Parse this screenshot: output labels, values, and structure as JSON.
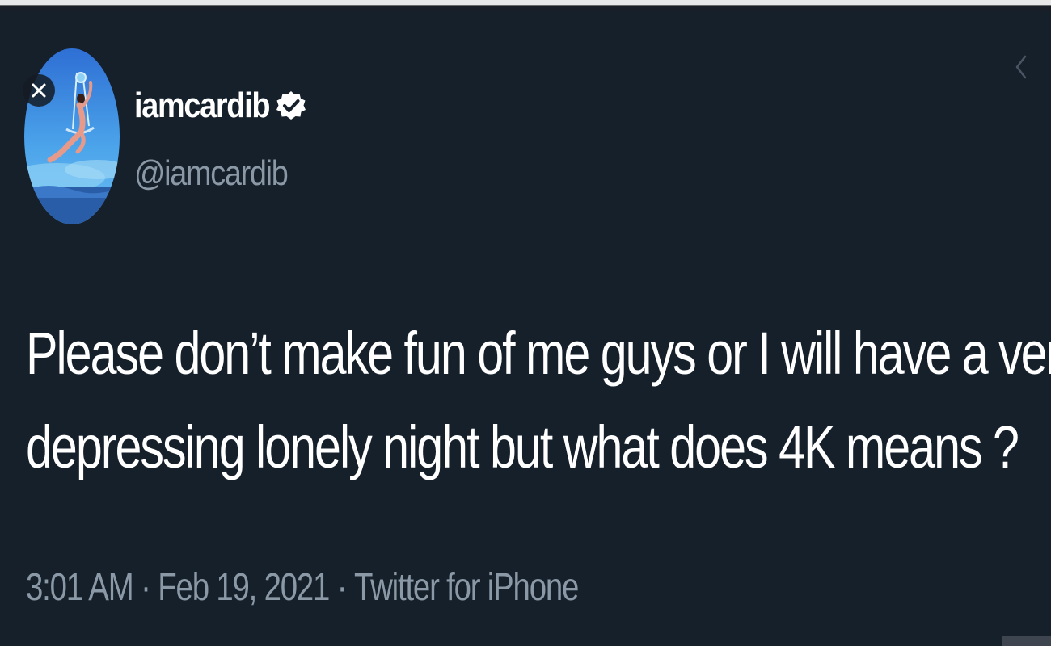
{
  "tweet": {
    "author": {
      "display_name": "iamcardib",
      "handle": "@iamcardib",
      "verified": true
    },
    "text_lines": [
      "Please don’t make fun of me guys or I will have a very",
      "depressing lonely night but what does 4K means ?"
    ],
    "meta": {
      "time": "3:01 AM",
      "separator": "·",
      "date": "Feb 19, 2021",
      "source": "Twitter for iPhone"
    }
  },
  "icons": {
    "close": "close-icon",
    "back": "chevron-left-icon",
    "verified": "verified-badge-icon"
  },
  "colors": {
    "background": "#15202b",
    "primary_text": "#ffffff",
    "secondary_text": "#8b98a5"
  }
}
